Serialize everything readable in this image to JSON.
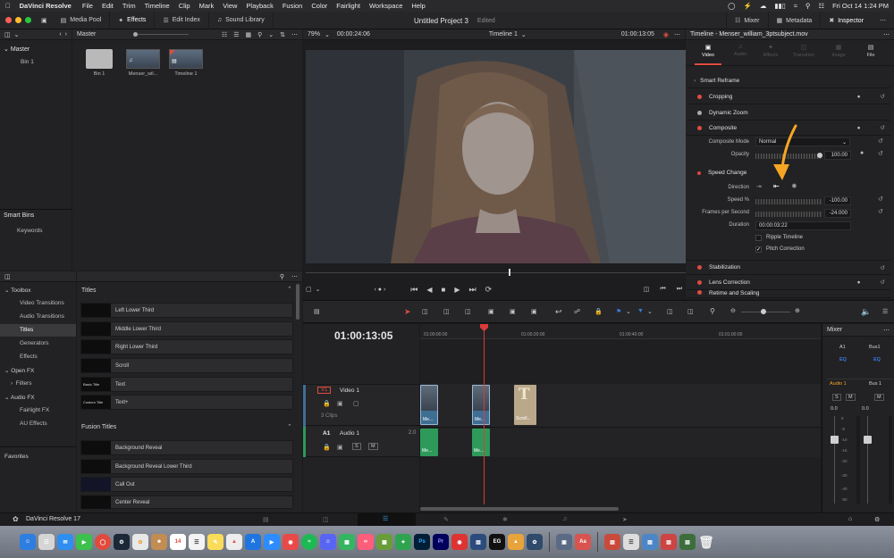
{
  "menubar": {
    "app": "DaVinci Resolve",
    "items": [
      "File",
      "Edit",
      "Trim",
      "Timeline",
      "Clip",
      "Mark",
      "View",
      "Playback",
      "Fusion",
      "Color",
      "Fairlight",
      "Workspace",
      "Help"
    ],
    "datetime": "Fri Oct 14  1:24 PM"
  },
  "toolbar": {
    "media_pool": "Media Pool",
    "effects": "Effects",
    "edit_index": "Edit Index",
    "sound_library": "Sound Library",
    "project_title": "Untitled Project 3",
    "project_status": "Edited",
    "mixer": "Mixer",
    "metadata": "Metadata",
    "inspector": "Inspector"
  },
  "media_pool": {
    "bin_header": "Master",
    "tree_root": "Master",
    "tree_child": "Bin 1",
    "clips": [
      {
        "label": "Bin 1"
      },
      {
        "label": "Menser_wil..."
      },
      {
        "label": "Timeline 1"
      }
    ],
    "smart_bins": "Smart Bins",
    "keywords": "Keywords"
  },
  "effects_library": {
    "tree": [
      "Toolbox",
      "Video Transitions",
      "Audio Transitions",
      "Titles",
      "Generators",
      "Effects",
      "Open FX",
      "Filters",
      "Audio FX",
      "Fairlight FX",
      "AU Effects"
    ],
    "favorites": "Favorites",
    "titles_header": "Titles",
    "titles": [
      {
        "thumb": "",
        "label": "Left Lower Third"
      },
      {
        "thumb": "",
        "label": "Middle Lower Third"
      },
      {
        "thumb": "",
        "label": "Right Lower Third"
      },
      {
        "thumb": "",
        "label": "Scroll"
      },
      {
        "thumb": "Basic Title",
        "label": "Text"
      },
      {
        "thumb": "Custom Title",
        "label": "Text+"
      }
    ],
    "fusion_header": "Fusion Titles",
    "fusion": [
      {
        "label": "Background Reveal"
      },
      {
        "label": "Background Reveal Lower Third"
      },
      {
        "label": "Call Out"
      },
      {
        "label": "Center Reveal"
      }
    ]
  },
  "viewer": {
    "zoom": "79%",
    "source_tc": "00:00:24:06",
    "timeline_name": "Timeline 1",
    "record_tc": "01:00:13:05",
    "playhead_tc": "01:00:13:05"
  },
  "inspector": {
    "title": "Timeline - Menser_william_3ptsubject.mov",
    "tabs": [
      "Video",
      "Audio",
      "Effects",
      "Transition",
      "Image",
      "File"
    ],
    "smart_reframe": "Smart Reframe",
    "cropping": "Cropping",
    "dynamic_zoom": "Dynamic Zoom",
    "composite": "Composite",
    "composite_mode_label": "Composite Mode",
    "composite_mode_value": "Normal",
    "opacity_label": "Opacity",
    "opacity_value": "100.00",
    "speed_change": "Speed Change",
    "direction_label": "Direction",
    "speed_label": "Speed %",
    "speed_value": "-100.00",
    "fps_label": "Frames per Second",
    "fps_value": "-24.000",
    "duration_label": "Duration",
    "duration_value": "00:00:03:22",
    "ripple_timeline": "Ripple Timeline",
    "pitch_correction": "Pitch Correction",
    "stabilization": "Stabilization",
    "lens_correction": "Lens Correction",
    "retime_scaling": "Retime and Scaling"
  },
  "timeline": {
    "ruler": [
      "01:00:00:00",
      "01:00:20:00",
      "01:00:40:00",
      "01:01:00:00"
    ],
    "v1_tag": "V1",
    "v1_name": "Video 1",
    "v1_count": "3 Clips",
    "a1_tag": "A1",
    "a1_name": "Audio 1",
    "a1_level": "2.0",
    "clip_video_1": "Me...",
    "clip_video_2": "Me...",
    "clip_title": "Scroll...",
    "clip_audio_1": "Me...",
    "clip_audio_2": "Me..."
  },
  "mixer": {
    "title": "Mixer",
    "ch1": "A1",
    "ch2": "Bus1",
    "eq": "EQ",
    "audio1": "Audio 1",
    "bus1": "Bus 1",
    "s": "S",
    "m": "M",
    "level1": "0.0",
    "level2": "0.0",
    "scale": [
      "0",
      "-5",
      "-10",
      "-15",
      "-20",
      "-30",
      "-40",
      "-50"
    ]
  },
  "pagebar": {
    "app_name": "DaVinci Resolve 17"
  },
  "colors": {
    "accent_red": "#e14c40",
    "clip_blue": "#3f6e93",
    "audio_green": "#2e9a5a",
    "playhead": "#d93a3a",
    "arrow_orange": "#f5a623"
  }
}
